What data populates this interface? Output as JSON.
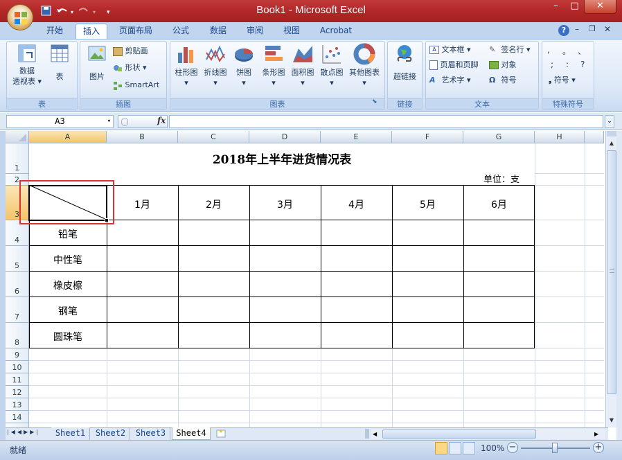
{
  "window": {
    "title": "Book1 - Microsoft Excel"
  },
  "ribbon": {
    "tabs": [
      "开始",
      "插入",
      "页面布局",
      "公式",
      "数据",
      "审阅",
      "视图",
      "Acrobat"
    ],
    "active_tab": "插入",
    "groups": {
      "tables": {
        "label": "表",
        "pivot_line1": "数据",
        "pivot_line2": "透视表",
        "table": "表"
      },
      "illustrations": {
        "label": "插图",
        "picture": "图片",
        "clipart": "剪贴画",
        "shapes": "形状",
        "smartart": "SmartArt"
      },
      "charts": {
        "label": "图表",
        "column": "柱形图",
        "line": "折线图",
        "pie": "饼图",
        "bar": "条形图",
        "area": "面积图",
        "scatter": "散点图",
        "other": "其他图表"
      },
      "links": {
        "label": "链接",
        "hyperlink": "超链接"
      },
      "text": {
        "label": "文本",
        "textbox": "文本框",
        "header_footer": "页眉和页脚",
        "wordart": "艺术字",
        "signature": "签名行",
        "object": "对象",
        "symbol": "符号"
      },
      "special": {
        "label": "特殊符号",
        "symbol": "符号",
        "chars": [
          ",",
          "。",
          "、",
          ";",
          ":",
          "?"
        ]
      }
    }
  },
  "formula_bar": {
    "name_box": "A3",
    "fx": "fx",
    "content": ""
  },
  "columns": [
    "A",
    "B",
    "C",
    "D",
    "E",
    "F",
    "G",
    "H"
  ],
  "rows": [
    "1",
    "2",
    "3",
    "4",
    "5",
    "6",
    "7",
    "8",
    "9",
    "10",
    "11",
    "12",
    "13",
    "14"
  ],
  "sheet": {
    "title": "2018年上半年进货情况表",
    "unit": "单位：支",
    "months": [
      "1月",
      "2月",
      "3月",
      "4月",
      "5月",
      "6月"
    ],
    "items": [
      "铅笔",
      "中性笔",
      "橡皮檫",
      "钢笔",
      "圆珠笔"
    ]
  },
  "sheet_tabs": [
    "Sheet1",
    "Sheet2",
    "Sheet3",
    "Sheet4"
  ],
  "active_sheet": "Sheet4",
  "status": {
    "text": "就绪",
    "zoom": "100%"
  }
}
